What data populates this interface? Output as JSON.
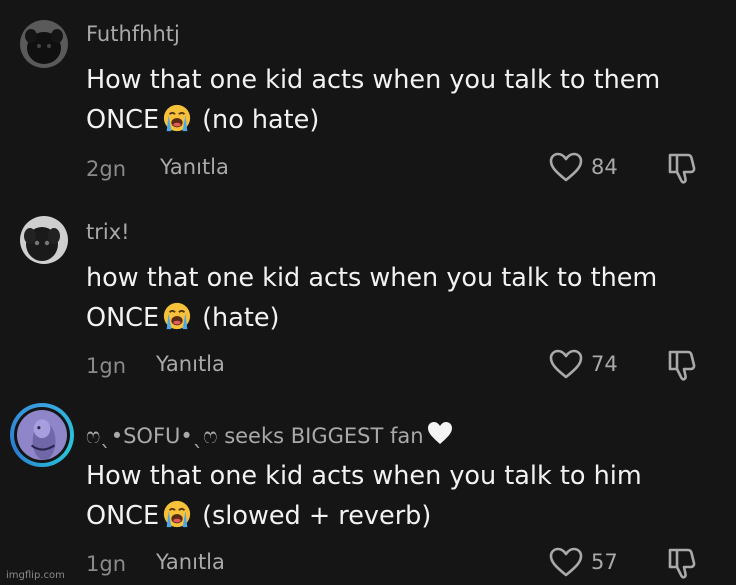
{
  "comments": [
    {
      "username": "Futhfhhtj",
      "line1": "How that one kid acts when you talk to them",
      "line2_before": "ONCE",
      "line2_after": "(no hate)",
      "time": "2gn",
      "reply": "Yanıtla",
      "likes": "84",
      "emoji": "loudly-crying-face-icon"
    },
    {
      "username": "trix!",
      "line1": "how that one kid acts when you talk to them",
      "line2_before": "ONCE",
      "line2_after": "(hate)",
      "time": "1gn",
      "reply": "Yanıtla",
      "likes": "74",
      "emoji": "loudly-crying-face-icon"
    },
    {
      "username": "ෆˎ•SOFU•ˎෆ seeks BIGGEST fan",
      "line1": "How that one kid acts when you talk to him",
      "line2_before": "ONCE",
      "line2_after": "(slowed + reverb)",
      "time": "1gn",
      "reply": "Yanıtla",
      "likes": "57",
      "emoji": "loudly-crying-face-icon"
    }
  ],
  "watermark": "imgflip.com",
  "colors": {
    "background": "#151515",
    "primary_text": "#f2f2f2",
    "secondary_text": "#a9a9a9",
    "story_ring": "#3aa0e0"
  },
  "icons": [
    "heart-outline-icon",
    "thumbs-down-icon",
    "white-heart-icon",
    "loudly-crying-face-icon"
  ]
}
